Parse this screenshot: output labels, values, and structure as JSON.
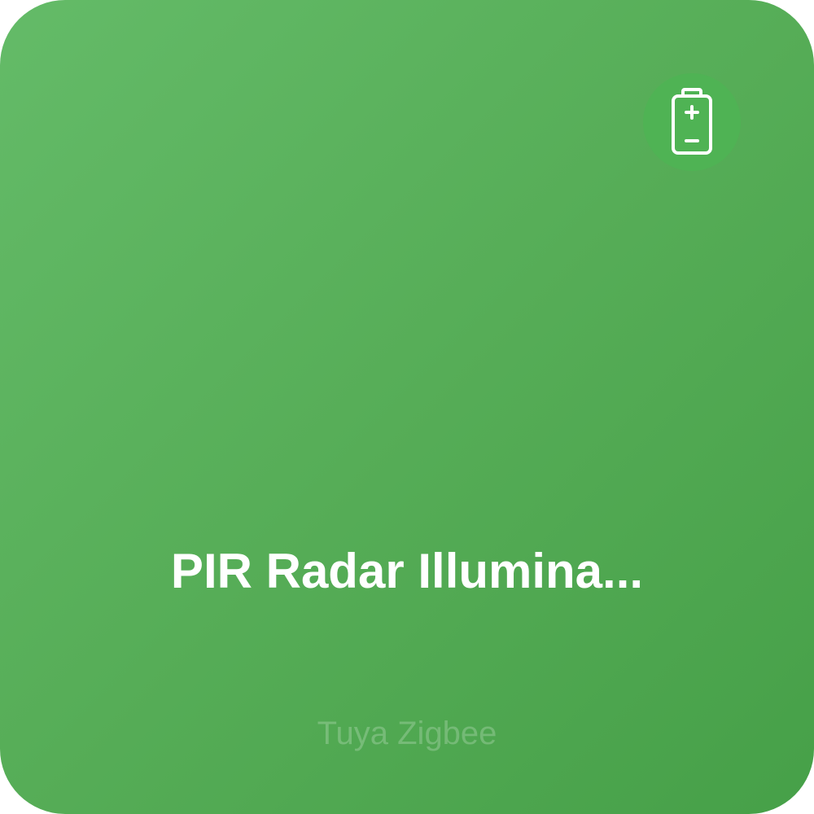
{
  "device": {
    "name": "PIR Radar Illumina...",
    "subtitle": "Tuya Zigbee",
    "status_icon": "battery-icon"
  },
  "colors": {
    "card_gradient_start": "#64bb68",
    "card_gradient_end": "#46a048",
    "badge_background": "#4fb354",
    "text_primary": "#ffffff"
  }
}
